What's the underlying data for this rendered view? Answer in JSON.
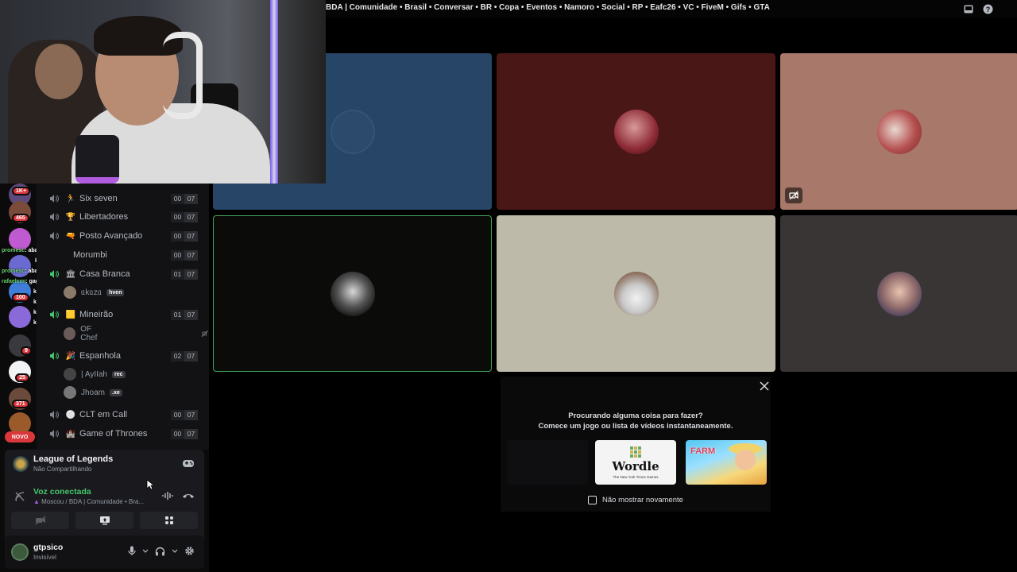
{
  "titlebar": {
    "title": "BDA | Comunidade • Brasil • Conversar • BR • Copa • Eventos • Namoro • Social • RP • Eafc26 • VC • FiveM • Gifs • GTA",
    "icons": [
      "inbox-icon",
      "help-icon"
    ]
  },
  "rail": {
    "badges": [
      "1K+",
      "465",
      "100",
      "371",
      "25",
      "4",
      "9"
    ],
    "novo": "NOVO",
    "chat": [
      {
        "user": "promesc",
        "text": "abafa po"
      },
      {
        "user": "",
        "text": "kkkkkkkkk"
      },
      {
        "user": "promesc",
        "text": "abafa po"
      },
      {
        "user": "rafaelczn",
        "text": "gag de la gag"
      },
      {
        "user": "",
        "text": "k"
      },
      {
        "user": "",
        "text": "k"
      },
      {
        "user": "",
        "text": "k"
      },
      {
        "user": "",
        "text": "k"
      }
    ]
  },
  "channels": [
    {
      "name": "Six seven",
      "count": "00",
      "cap": "07"
    },
    {
      "name": "Libertadores",
      "count": "00",
      "cap": "07"
    },
    {
      "name": "Posto Avançado",
      "count": "00",
      "cap": "07"
    },
    {
      "name": "Morumbi",
      "count": "00",
      "cap": "07"
    },
    {
      "name": "Casa Branca",
      "count": "01",
      "cap": "07"
    },
    {
      "name": "Mineirão",
      "count": "01",
      "cap": "07"
    },
    {
      "name": "Espanhola",
      "count": "02",
      "cap": "07"
    },
    {
      "name": "CLT em Call",
      "count": "00",
      "cap": "07"
    },
    {
      "name": "Game of Thrones",
      "count": "00",
      "cap": "07"
    }
  ],
  "members": {
    "casa_branca": {
      "name": "ᥲkᥲzᥲ",
      "tag": "hven"
    },
    "mineirao": {
      "name": "OF Chef"
    },
    "espanhola_1": {
      "name": "| AyIIah",
      "tag": "rec"
    },
    "espanhola_2": {
      "name": "Jhoam",
      "tag": ".xe"
    }
  },
  "activity": {
    "game": "League of Legends",
    "status": "Não Compartilhando"
  },
  "voice": {
    "title": "Voz conectada",
    "channel": "Moscou / BDA | Comunidade • Bra..."
  },
  "user": {
    "name": "gtpsico",
    "status": "Invisível"
  },
  "popup": {
    "line1": "Procurando alguma coisa para fazer?",
    "line2": "Comece um jogo ou lista de vídeos instantaneamente.",
    "wordle": "Wordle",
    "wordle_sub": "The New York Times Games",
    "farm": "FARM",
    "checkbox": "Não mostrar novamente"
  },
  "colors": {
    "accent_green": "#45c46b",
    "badge_red": "#da373c",
    "tile_blue": "#274566",
    "tile_maroon": "#4a1717",
    "tile_tan": "#a8796a",
    "tile_black": "#0b0b0a",
    "tile_beige": "#bdbaa9",
    "tile_brown": "#3a3535"
  }
}
